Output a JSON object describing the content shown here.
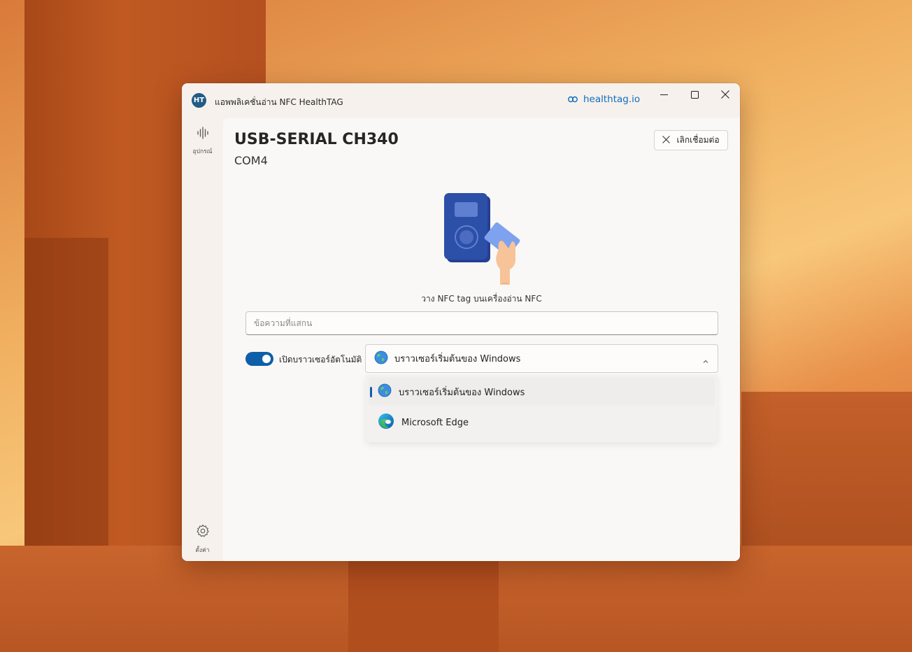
{
  "window": {
    "title": "แอพพลิเคชั่นอ่าน NFC HealthTAG",
    "logo_text": "HT",
    "link_text": "healthtag.io"
  },
  "sidebar": {
    "items": [
      {
        "label": "อุปกรณ์",
        "icon": "sound-wave-icon"
      },
      {
        "label": "ตั้งค่า",
        "icon": "gear-icon"
      }
    ]
  },
  "device": {
    "name": "USB-SERIAL CH340",
    "port": "COM4",
    "disconnect_label": "เลิกเชื่อมต่อ"
  },
  "instruction": "วาง NFC tag บนเครื่องอ่าน NFC",
  "scan_input": {
    "placeholder": "ข้อความที่แสกน",
    "value": ""
  },
  "auto_browser": {
    "toggle_label": "เปิดบราวเซอร์อัตโนมัติ",
    "enabled": true
  },
  "browser_select": {
    "selected": "บราวเซอร์เริ่มต้นของ Windows",
    "options": [
      {
        "label": "บราวเซอร์เริ่มต้นของ Windows",
        "icon": "globe-icon"
      },
      {
        "label": "Microsoft Edge",
        "icon": "edge-icon"
      }
    ]
  },
  "colors": {
    "accent": "#0f5fa8",
    "link": "#0f6cbd",
    "reader": "#2c4fa8"
  }
}
